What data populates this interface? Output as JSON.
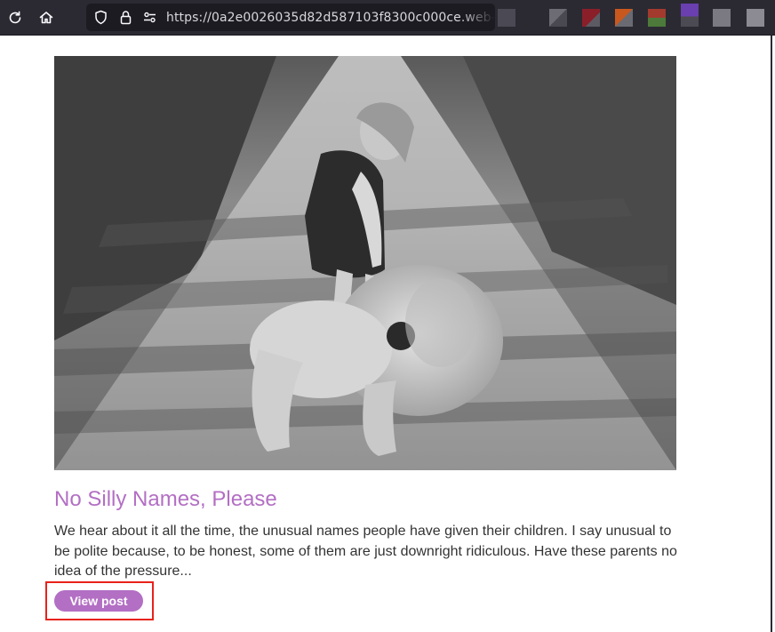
{
  "browser": {
    "url": "https://0a2e0026035d82d587103f8300c000ce.web-"
  },
  "post": {
    "title": "No Silly Names, Please",
    "summary": "We hear about it all the time, the unusual names people have given their children. I say unusual to be polite because, to be honest, some of them are just downright ridiculous. Have these parents no idea of the pressure...",
    "button_label": "View post"
  },
  "colors": {
    "accent": "#b36fc4",
    "highlight": "#e8221b",
    "toolbar": "#2b2a33"
  }
}
